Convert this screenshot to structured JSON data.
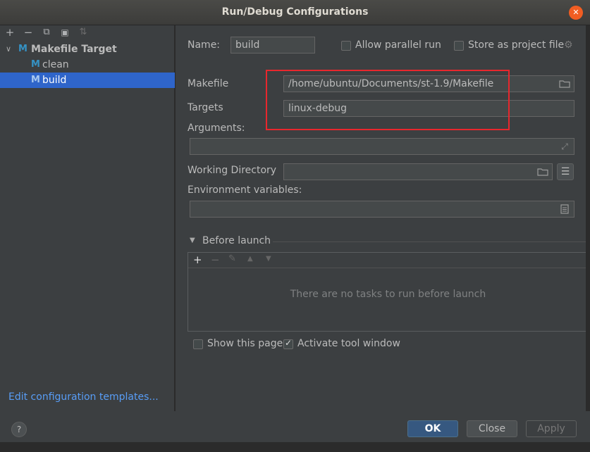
{
  "window": {
    "title": "Run/Debug Configurations"
  },
  "toolbar": {
    "add": "+",
    "remove": "−",
    "copy": "⧉",
    "folder": "▣",
    "sort": "⇅"
  },
  "tree": {
    "group_label": "Makefile Target",
    "items": [
      {
        "label": "clean"
      },
      {
        "label": "build"
      }
    ],
    "icon_letter": "M",
    "expander": "∨"
  },
  "left_footer": {
    "link": "Edit configuration templates..."
  },
  "form": {
    "name_label": "Name:",
    "name_value": "build",
    "allow_parallel_label": "Allow parallel run",
    "store_as_project_label": "Store as project file",
    "makefile_label": "Makefile",
    "makefile_value": "/home/ubuntu/Documents/st-1.9/Makefile",
    "targets_label": "Targets",
    "targets_value": "linux-debug",
    "arguments_label": "Arguments:",
    "arguments_value": "",
    "working_dir_label": "Working Directory",
    "working_dir_value": "",
    "env_label": "Environment variables:",
    "env_value": ""
  },
  "before_launch": {
    "label": "Before launch",
    "empty_text": "There are no tasks to run before launch",
    "add": "+",
    "remove": "−",
    "up": "▲",
    "down": "▼"
  },
  "options": {
    "show_page_label": "Show this page",
    "show_page_checked": false,
    "activate_tool_label": "Activate tool window",
    "activate_tool_checked": true
  },
  "buttons": {
    "help": "?",
    "ok": "OK",
    "close": "Close",
    "apply": "Apply"
  },
  "colors": {
    "accent": "#2f65ca",
    "link": "#589df6",
    "highlight_box": "#e8272d",
    "ok_button": "#365880"
  }
}
